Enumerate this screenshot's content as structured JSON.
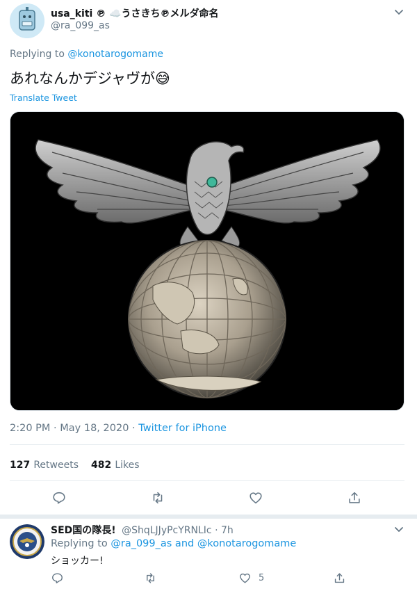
{
  "tweet": {
    "display_name": "usa_kiti ℗ ☁️うさきち℗メルダ命名",
    "handle": "@ra_099_as",
    "replying_to_label": "Replying to",
    "replying_to_user": "@konotarogomame",
    "text": "あれなんかデジャヴが😅",
    "translate_label": "Translate Tweet",
    "time": "2:20 PM",
    "separator": "·",
    "date": "May 18, 2020",
    "source": "Twitter for iPhone",
    "retweets_count": "127",
    "retweets_label": "Retweets",
    "likes_count": "482",
    "likes_label": "Likes"
  },
  "reply": {
    "display_name": "SED国の隊長!",
    "handle": "@ShqLJJyPcYRNLIc",
    "separator": "·",
    "time_ago": "7h",
    "replying_to_label": "Replying to",
    "replying_to_users": "@ra_099_as and @konotarogomame",
    "text": "ショッカー!",
    "like_count": "5"
  },
  "colors": {
    "link": "#1b95e0",
    "muted": "#657786",
    "text": "#14171a",
    "divider": "#e6ecf0"
  },
  "icons": {
    "tweet_avatar": "robot-avatar-icon",
    "reply_avatar": "seal-avatar-icon",
    "more_menu": "chevron-down-icon",
    "reply_action": "reply-icon",
    "retweet_action": "retweet-icon",
    "like_action": "heart-icon",
    "share_action": "share-icon"
  }
}
